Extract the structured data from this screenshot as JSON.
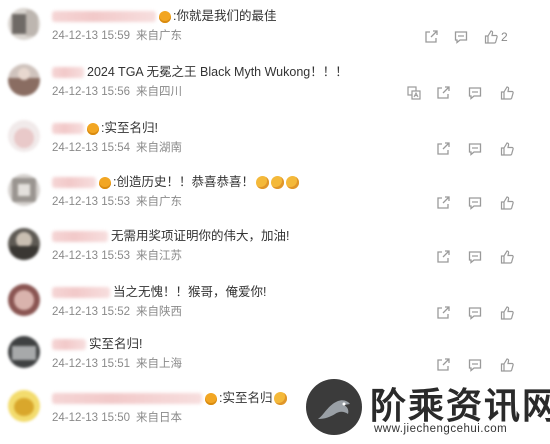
{
  "comments": [
    {
      "text": ":你就是我们的最佳",
      "time": "24-12-13 15:59",
      "source": "来自广东",
      "likes": "2",
      "badge": true,
      "emojis": 0,
      "actions": [
        "share",
        "comment",
        "like"
      ]
    },
    {
      "text": "2024 TGA 无冕之王 Black Myth Wukong！！！",
      "time": "24-12-13 15:56",
      "source": "来自四川",
      "likes": "",
      "badge": false,
      "emojis": 0,
      "actions": [
        "translate",
        "share",
        "comment",
        "like"
      ]
    },
    {
      "text": ":实至名归!",
      "time": "24-12-13 15:54",
      "source": "来自湖南",
      "likes": "",
      "badge": true,
      "emojis": 0,
      "actions": [
        "share",
        "comment",
        "like"
      ]
    },
    {
      "text": ":创造历史！！恭喜恭喜！",
      "time": "24-12-13 15:53",
      "source": "来自广东",
      "likes": "",
      "badge": true,
      "emojis": 3,
      "actions": [
        "share",
        "comment",
        "like"
      ]
    },
    {
      "text": "无需用奖项证明你的伟大，加油!",
      "time": "24-12-13 15:53",
      "source": "来自江苏",
      "likes": "",
      "badge": false,
      "emojis": 0,
      "actions": [
        "share",
        "comment",
        "like"
      ]
    },
    {
      "text": "当之无愧！！猴哥，俺爱你!",
      "time": "24-12-13 15:52",
      "source": "来自陕西",
      "likes": "",
      "badge": false,
      "emojis": 0,
      "actions": [
        "share",
        "comment",
        "like"
      ]
    },
    {
      "text": "实至名归!",
      "time": "24-12-13 15:51",
      "source": "来自上海",
      "likes": "",
      "badge": false,
      "emojis": 0,
      "actions": [
        "share",
        "comment",
        "like"
      ]
    },
    {
      "text": ":实至名归",
      "time": "24-12-13 15:50",
      "source": "来自日本",
      "likes": "",
      "badge": true,
      "emojis": 1,
      "actions": []
    }
  ],
  "watermark": {
    "title": "阶乘资讯网",
    "url": "www.jiechengcehui.com"
  },
  "colors": {
    "meta": "#8a8a8a",
    "text": "#333333",
    "icon": "#9a9a9a"
  }
}
